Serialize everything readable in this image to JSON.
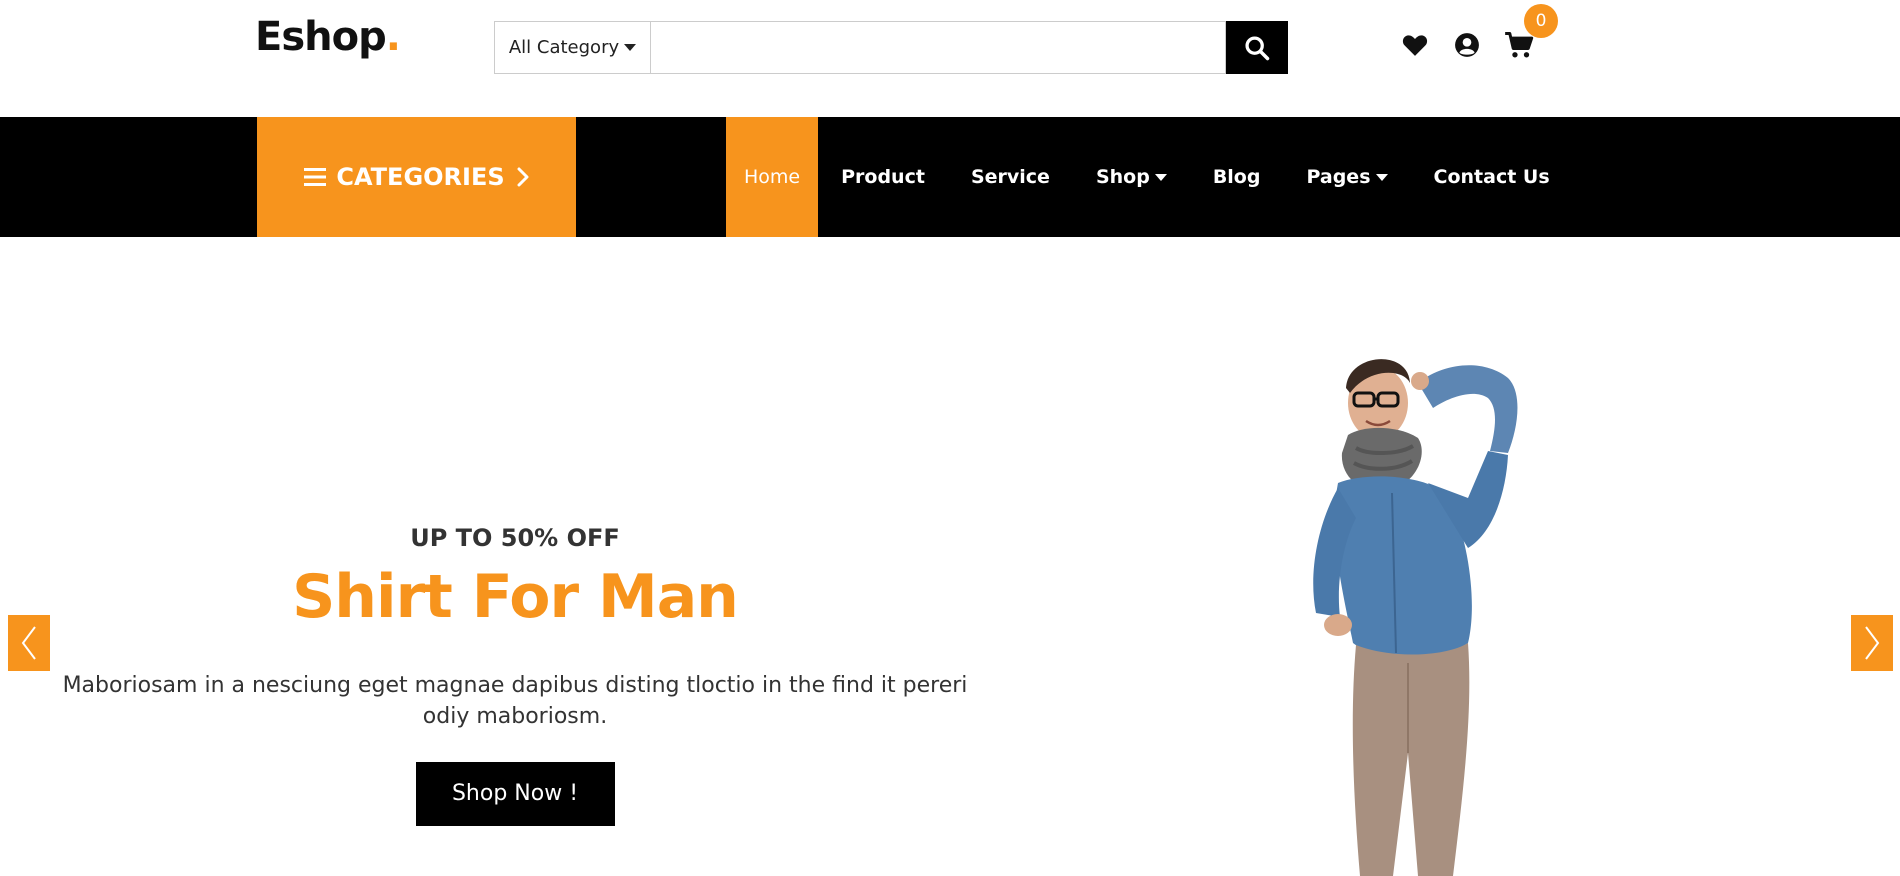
{
  "header": {
    "logo_text": "Eshop",
    "logo_dot": ".",
    "category_select": "All Category",
    "search_placeholder": "",
    "cart_count": "0"
  },
  "nav": {
    "categories_label": "CATEGORIES",
    "items": [
      {
        "label": "Home",
        "active": true
      },
      {
        "label": "Product"
      },
      {
        "label": "Service"
      },
      {
        "label": "Shop",
        "dropdown": true
      },
      {
        "label": "Blog"
      },
      {
        "label": "Pages",
        "dropdown": true
      },
      {
        "label": "Contact Us"
      }
    ]
  },
  "hero": {
    "promo": "UP TO 50% OFF",
    "headline": "Shirt For Man",
    "description": "Maboriosam in a nesciung eget magnae dapibus disting tloctio in the find it pereri odiy maboriosm.",
    "cta": "Shop Now !"
  },
  "colors": {
    "accent": "#f7941d",
    "dark": "#000000"
  },
  "icons": [
    "search-icon",
    "heart-icon",
    "user-icon",
    "cart-icon",
    "bars-icon",
    "chevron-right-icon",
    "chevron-left-icon",
    "caret-down-icon"
  ]
}
